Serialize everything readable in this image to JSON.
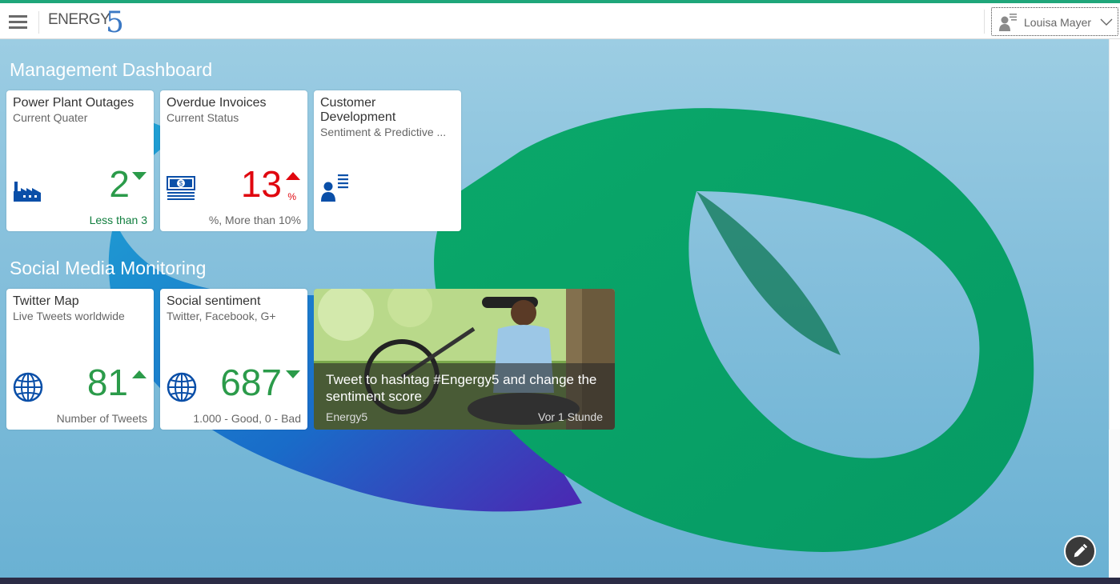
{
  "shell": {
    "logo_text": "ENERGY",
    "logo_digit": "5",
    "user_name": "Louisa Mayer",
    "accent_color": "#1fa67a"
  },
  "groups": [
    {
      "title": "Management Dashboard",
      "tiles": [
        {
          "title": "Power Plant Outages",
          "subtitle": "Current Quater",
          "icon": "factory-icon",
          "value": "2",
          "unit": "",
          "trend": "down",
          "value_color": "#2b9b4a",
          "footer": "Less than 3",
          "footer_color": "#107e3e"
        },
        {
          "title": "Overdue Invoices",
          "subtitle": "Current Status",
          "icon": "money-icon",
          "value": "13",
          "unit": "%",
          "trend": "up",
          "value_color": "#e0070f",
          "footer": "%, More than 10%",
          "footer_color": "#666666"
        },
        {
          "title": "Customer Development",
          "subtitle": "Sentiment & Predictive ...",
          "icon": "customer-icon"
        }
      ]
    },
    {
      "title": "Social Media Monitoring",
      "tiles": [
        {
          "title": "Twitter Map",
          "subtitle": "Live Tweets worldwide",
          "icon": "globe-icon",
          "value": "81",
          "trend": "up",
          "value_color": "#2b9b4a",
          "footer": "Number of Tweets",
          "footer_color": "#666666"
        },
        {
          "title": "Social sentiment",
          "subtitle": "Twitter, Facebook, G+",
          "icon": "globe-icon",
          "value": "687",
          "trend": "down",
          "value_color": "#2b9b4a",
          "footer": "1.000 - Good, 0 - Bad",
          "footer_color": "#666666"
        }
      ],
      "news": {
        "text": "Tweet to hashtag #Engergy5 and change the sentiment score",
        "source": "Energy5",
        "time": "Vor 1 Stunde"
      }
    }
  ]
}
